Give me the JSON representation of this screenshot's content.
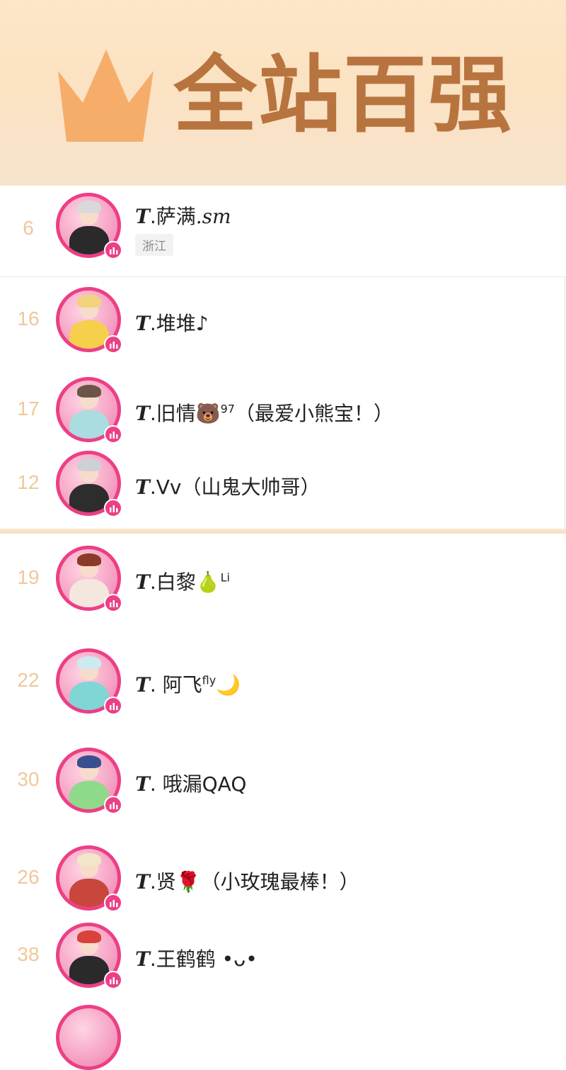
{
  "banner": {
    "title": "全站百强",
    "icon": "crown-icon",
    "colors": {
      "bg": "#fbe2c2",
      "title": "#b8743f",
      "crown": "#f4a35a"
    }
  },
  "accent_color": "#ec3f86",
  "rank_color": "#f0c79b",
  "entries": [
    {
      "rank": "6",
      "prefix": "T",
      "name": ".萨满",
      "suffix": ".sm",
      "region": "浙江"
    },
    {
      "rank": "16",
      "prefix": "T",
      "name": ".堆堆♪"
    },
    {
      "rank": "17",
      "prefix": "T",
      "name": ".旧情🐻",
      "sup": "97",
      "note": "（最爱小熊宝！）"
    },
    {
      "rank": "12",
      "prefix": "T",
      "name": ".Vv（山鬼大帅哥）"
    },
    {
      "rank": "19",
      "prefix": "T",
      "name": ".白黎🍐",
      "sup": "Li"
    },
    {
      "rank": "22",
      "prefix": "T",
      "name": ". 阿飞",
      "sup": "fly",
      "tail": "🌙"
    },
    {
      "rank": "30",
      "prefix": "T",
      "name": ". 哦漏QAQ"
    },
    {
      "rank": "26",
      "prefix": "T",
      "name": ".贤🌹（小玫瑰最棒！）"
    },
    {
      "rank": "38",
      "prefix": "T",
      "name": ".王鹤鹤 •ᴗ•"
    }
  ]
}
